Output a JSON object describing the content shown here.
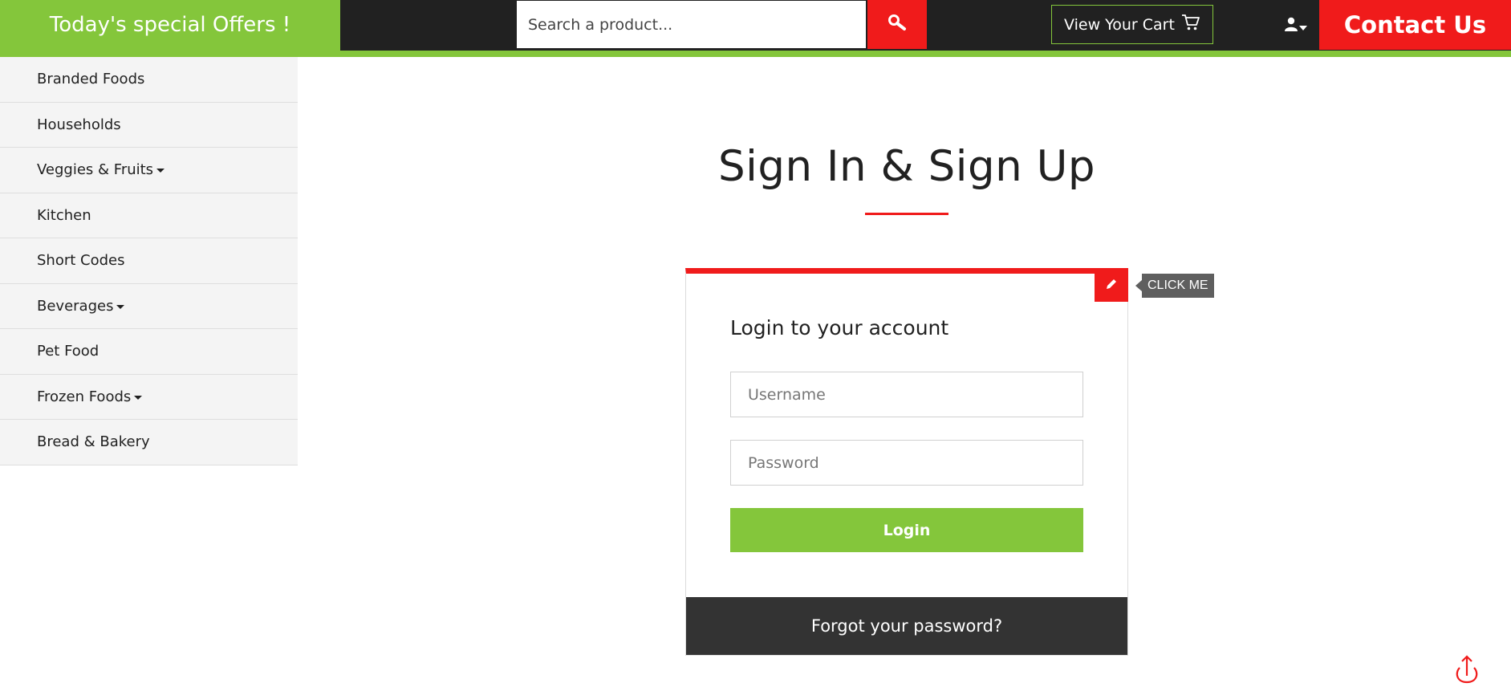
{
  "header": {
    "offers_text": "Today's special Offers !",
    "search_placeholder": "Search a product...",
    "cart_label": "View Your Cart",
    "contact_label": "Contact Us"
  },
  "sidebar": {
    "items": [
      {
        "label": "Branded Foods",
        "has_dropdown": false
      },
      {
        "label": "Households",
        "has_dropdown": false
      },
      {
        "label": "Veggies & Fruits",
        "has_dropdown": true
      },
      {
        "label": "Kitchen",
        "has_dropdown": false
      },
      {
        "label": "Short Codes",
        "has_dropdown": false
      },
      {
        "label": "Beverages",
        "has_dropdown": true
      },
      {
        "label": "Pet Food",
        "has_dropdown": false
      },
      {
        "label": "Frozen Foods",
        "has_dropdown": true
      },
      {
        "label": "Bread & Bakery",
        "has_dropdown": false
      }
    ]
  },
  "main": {
    "title": "Sign In & Sign Up",
    "tooltip": "CLICK ME",
    "card_heading": "Login to your account",
    "username_placeholder": "Username",
    "password_placeholder": "Password",
    "login_label": "Login",
    "forgot_label": "Forgot your password?"
  },
  "icons": {
    "search": "search-icon",
    "cart": "cart-icon",
    "user": "user-icon",
    "edit": "pencil-icon",
    "scroll_top": "arrow-up-icon"
  },
  "colors": {
    "green": "#84c63b",
    "red": "#f01b1b",
    "dark": "#212121",
    "footer_dark": "#333333"
  }
}
